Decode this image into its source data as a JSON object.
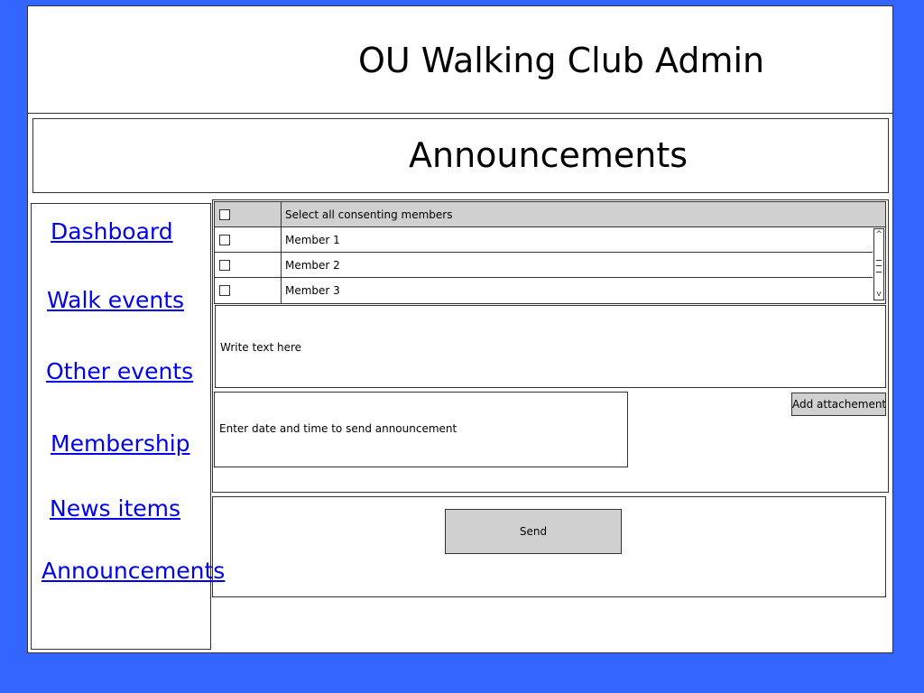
{
  "app": {
    "title": "OU Walking Club Admin"
  },
  "page": {
    "title": "Announcements"
  },
  "sidebar": {
    "items": [
      {
        "label": "Dashboard"
      },
      {
        "label": "Walk events"
      },
      {
        "label": "Other events"
      },
      {
        "label": "Membership"
      },
      {
        "label": "News items"
      },
      {
        "label": "Announcements"
      }
    ]
  },
  "members": {
    "select_all_label": "Select all consenting members",
    "rows": [
      {
        "label": "Member 1",
        "checked": false
      },
      {
        "label": "Member 2",
        "checked": false
      },
      {
        "label": "Member 3",
        "checked": false
      }
    ]
  },
  "message": {
    "placeholder": "Write text here"
  },
  "schedule": {
    "placeholder": "Enter date and time to send announcement"
  },
  "actions": {
    "attach_label": "Add attachement",
    "send_label": "Send"
  },
  "colors": {
    "background": "#3366ff",
    "link": "#0000ee",
    "button": "#d0d0d0"
  }
}
